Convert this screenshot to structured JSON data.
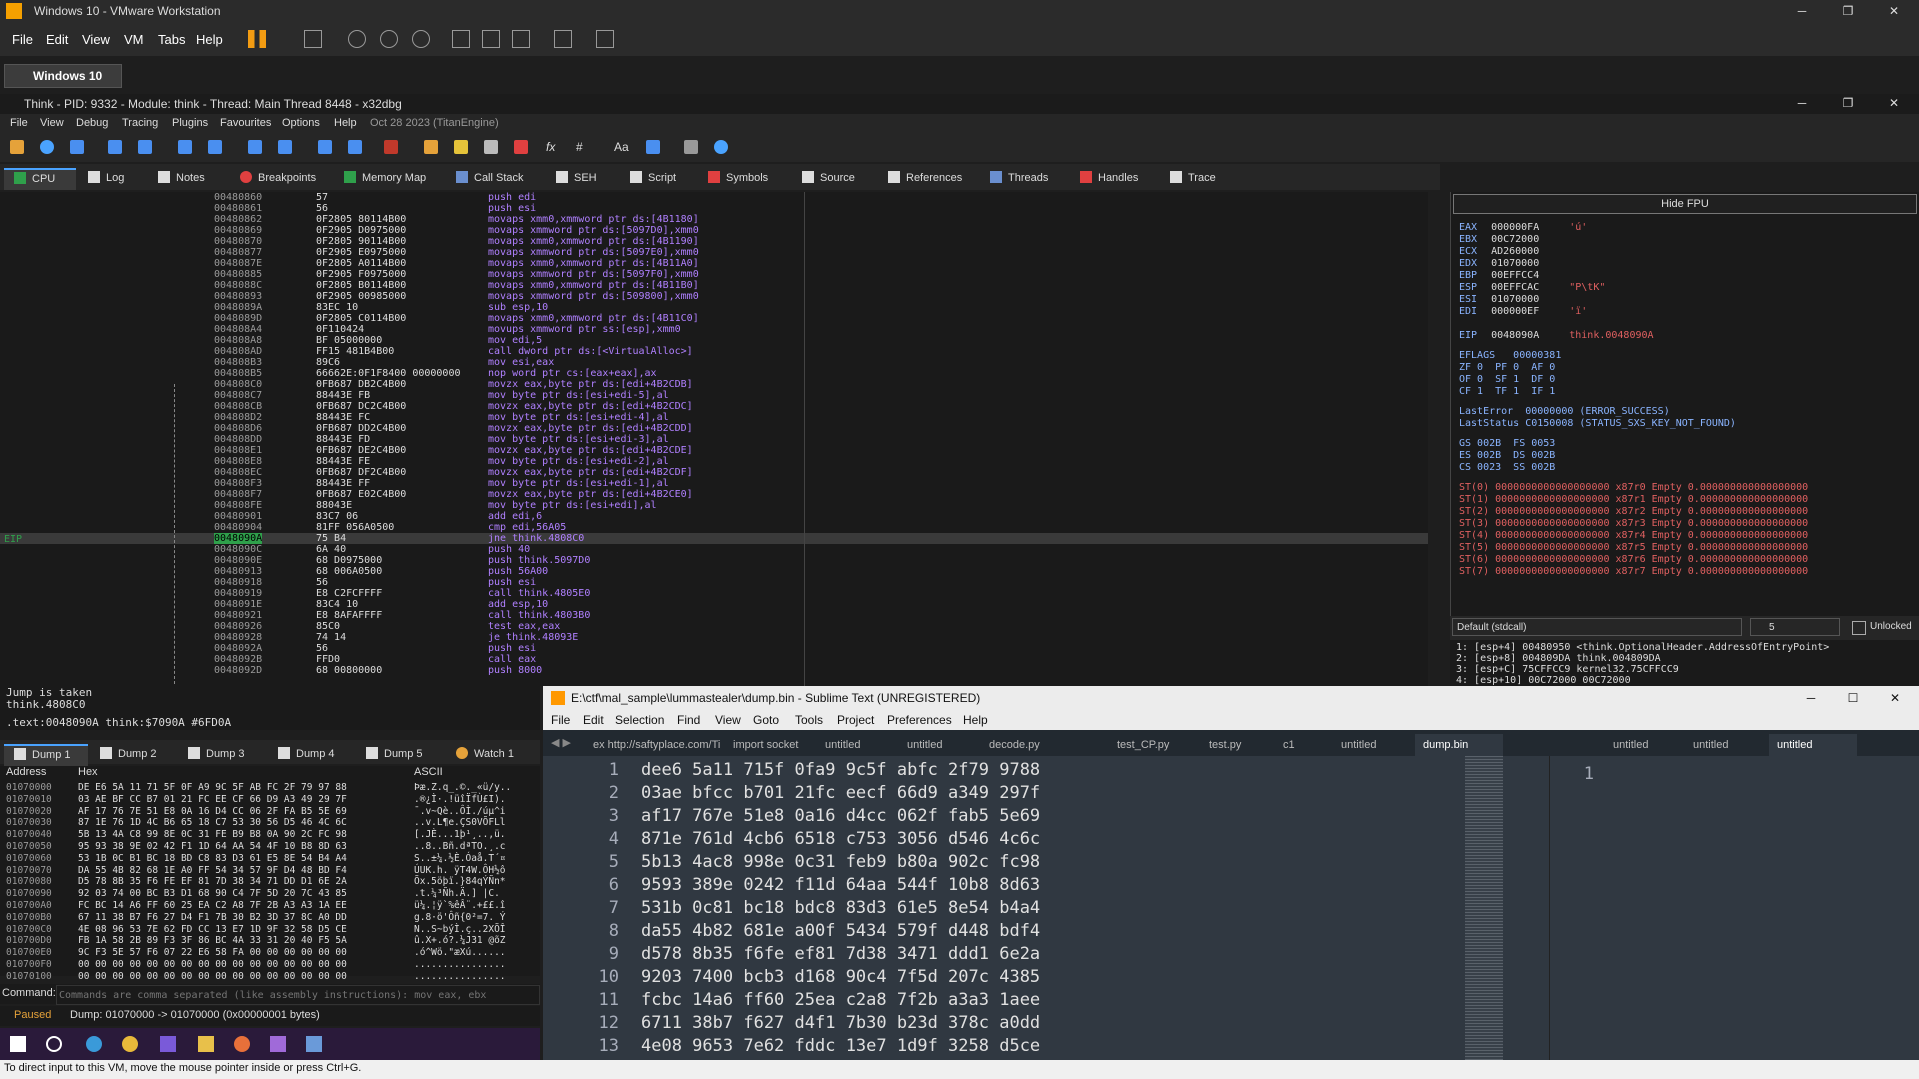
{
  "vmware": {
    "title": "Windows 10 - VMware Workstation",
    "menu": [
      "File",
      "Edit",
      "View",
      "VM",
      "Tabs",
      "Help"
    ],
    "tab": "Windows 10",
    "status": "To direct input to this VM, move the mouse pointer inside or press Ctrl+G."
  },
  "x64dbg": {
    "title": "Think - PID: 9332 - Module: think - Thread: Main Thread 8448 - x32dbg",
    "menu": [
      "File",
      "View",
      "Debug",
      "Tracing",
      "Plugins",
      "Favourites",
      "Options",
      "Help",
      "Oct 28 2023 (TitanEngine)"
    ],
    "tabs": [
      "CPU",
      "Log",
      "Notes",
      "Breakpoints",
      "Memory Map",
      "Call Stack",
      "SEH",
      "Script",
      "Symbols",
      "Source",
      "References",
      "Threads",
      "Handles",
      "Trace"
    ],
    "eip_label": "EIP",
    "disasm": [
      [
        "00480860",
        "57",
        "push edi"
      ],
      [
        "00480861",
        "56",
        "push esi"
      ],
      [
        "00480862",
        "0F2805 80114B00",
        "movaps xmm0,xmmword ptr ds:[4B1180]"
      ],
      [
        "00480869",
        "0F2905 D0975000",
        "movaps xmmword ptr ds:[5097D0],xmm0"
      ],
      [
        "00480870",
        "0F2805 90114B00",
        "movaps xmm0,xmmword ptr ds:[4B1190]"
      ],
      [
        "00480877",
        "0F2905 E0975000",
        "movaps xmmword ptr ds:[5097E0],xmm0"
      ],
      [
        "0048087E",
        "0F2805 A0114B00",
        "movaps xmm0,xmmword ptr ds:[4B11A0]"
      ],
      [
        "00480885",
        "0F2905 F0975000",
        "movaps xmmword ptr ds:[5097F0],xmm0"
      ],
      [
        "0048088C",
        "0F2805 B0114B00",
        "movaps xmm0,xmmword ptr ds:[4B11B0]"
      ],
      [
        "00480893",
        "0F2905 00985000",
        "movaps xmmword ptr ds:[509800],xmm0"
      ],
      [
        "0048089A",
        "83EC 10",
        "sub esp,10"
      ],
      [
        "0048089D",
        "0F2805 C0114B00",
        "movaps xmm0,xmmword ptr ds:[4B11C0]"
      ],
      [
        "004808A4",
        "0F110424",
        "movups xmmword ptr ss:[esp],xmm0"
      ],
      [
        "004808A8",
        "BF 05000000",
        "mov edi,5"
      ],
      [
        "004808AD",
        "FF15 481B4B00",
        "call dword ptr ds:[<VirtualAlloc>]"
      ],
      [
        "004808B3",
        "89C6",
        "mov esi,eax"
      ],
      [
        "004808B5",
        "66662E:0F1F8400 00000000",
        "nop word ptr cs:[eax+eax],ax"
      ],
      [
        "004808C0",
        "0FB687 DB2C4B00",
        "movzx eax,byte ptr ds:[edi+4B2CDB]"
      ],
      [
        "004808C7",
        "88443E FB",
        "mov byte ptr ds:[esi+edi-5],al"
      ],
      [
        "004808CB",
        "0FB687 DC2C4B00",
        "movzx eax,byte ptr ds:[edi+4B2CDC]"
      ],
      [
        "004808D2",
        "88443E FC",
        "mov byte ptr ds:[esi+edi-4],al"
      ],
      [
        "004808D6",
        "0FB687 DD2C4B00",
        "movzx eax,byte ptr ds:[edi+4B2CDD]"
      ],
      [
        "004808DD",
        "88443E FD",
        "mov byte ptr ds:[esi+edi-3],al"
      ],
      [
        "004808E1",
        "0FB687 DE2C4B00",
        "movzx eax,byte ptr ds:[edi+4B2CDE]"
      ],
      [
        "004808E8",
        "88443E FE",
        "mov byte ptr ds:[esi+edi-2],al"
      ],
      [
        "004808EC",
        "0FB687 DF2C4B00",
        "movzx eax,byte ptr ds:[edi+4B2CDF]"
      ],
      [
        "004808F3",
        "88443E FF",
        "mov byte ptr ds:[esi+edi-1],al"
      ],
      [
        "004808F7",
        "0FB687 E02C4B00",
        "movzx eax,byte ptr ds:[edi+4B2CE0]"
      ],
      [
        "004808FE",
        "88043E",
        "mov byte ptr ds:[esi+edi],al"
      ],
      [
        "00480901",
        "83C7 06",
        "add edi,6"
      ],
      [
        "00480904",
        "81FF 056A0500",
        "cmp edi,56A05"
      ],
      [
        "0048090A",
        "75 B4",
        "jne think.4808C0"
      ],
      [
        "0048090C",
        "6A 40",
        "push 40"
      ],
      [
        "0048090E",
        "68 D0975000",
        "push think.5097D0"
      ],
      [
        "00480913",
        "68 006A0500",
        "push 56A00"
      ],
      [
        "00480918",
        "56",
        "push esi"
      ],
      [
        "00480919",
        "E8 C2FCFFFF",
        "call think.4805E0"
      ],
      [
        "0048091E",
        "83C4 10",
        "add esp,10"
      ],
      [
        "00480921",
        "E8 8AFAFFFF",
        "call think.4803B0"
      ],
      [
        "00480926",
        "85C0",
        "test eax,eax"
      ],
      [
        "00480928",
        "74 14",
        "je think.48093E"
      ],
      [
        "0048092A",
        "56",
        "push esi"
      ],
      [
        "0048092B",
        "FFD0",
        "call eax"
      ],
      [
        "0048092D",
        "68 00800000",
        "push 8000"
      ]
    ],
    "info": [
      "Jump is taken",
      "think.4808C0",
      ".text:0048090A think:$7090A #6FD0A"
    ],
    "hide_fpu": "Hide FPU",
    "registers": [
      [
        "EAX",
        "000000FA",
        "'ú'"
      ],
      [
        "EBX",
        "00C72000",
        ""
      ],
      [
        "ECX",
        "AD260000",
        ""
      ],
      [
        "EDX",
        "01070000",
        ""
      ],
      [
        "EBP",
        "00EFFCC4",
        ""
      ],
      [
        "ESP",
        "00EFFCAC",
        "\"P\\tK\""
      ],
      [
        "ESI",
        "01070000",
        ""
      ],
      [
        "EDI",
        "000000EF",
        "'ï'"
      ],
      [
        "",
        "",
        ""
      ],
      [
        "EIP",
        "0048090A",
        "think.0048090A"
      ]
    ],
    "flags": [
      "EFLAGS   00000381",
      "ZF 0  PF 0  AF 0",
      "OF 0  SF 1  DF 0",
      "CF 1  TF 1  IF 1"
    ],
    "errors": [
      "LastError  00000000 (ERROR_SUCCESS)",
      "LastStatus C0150008 (STATUS_SXS_KEY_NOT_FOUND)"
    ],
    "segs": [
      "GS 002B  FS 0053",
      "ES 002B  DS 002B",
      "CS 0023  SS 002B"
    ],
    "fpu": [
      "ST(0) 0000000000000000000 x87r0 Empty 0.000000000000000000",
      "ST(1) 0000000000000000000 x87r1 Empty 0.000000000000000000",
      "ST(2) 0000000000000000000 x87r2 Empty 0.000000000000000000",
      "ST(3) 0000000000000000000 x87r3 Empty 0.000000000000000000",
      "ST(4) 0000000000000000000 x87r4 Empty 0.000000000000000000",
      "ST(5) 0000000000000000000 x87r5 Empty 0.000000000000000000",
      "ST(6) 0000000000000000000 x87r6 Empty 0.000000000000000000",
      "ST(7) 0000000000000000000 x87r7 Empty 0.000000000000000000"
    ],
    "callconv": "Default (stdcall)",
    "argcount": "5",
    "unlocked": "Unlocked",
    "stack": [
      "1: [esp+4] 00480950 <think.OptionalHeader.AddressOfEntryPoint>",
      "2: [esp+8] 004809DA think.004809DA",
      "3: [esp+C] 75CFFCC9 kernel32.75CFFCC9",
      "4: [esp+10] 00C72000 00C72000"
    ],
    "dump_tabs": [
      "Dump 1",
      "Dump 2",
      "Dump 3",
      "Dump 4",
      "Dump 5",
      "Watch 1"
    ],
    "dump_headers": [
      "Address",
      "Hex",
      "ASCII"
    ],
    "dump": [
      [
        "01070000",
        "DE E6 5A 11 71 5F 0F A9 9C 5F AB FC 2F 79 97 88",
        "Þæ.Z.q_.©._«ü/y.."
      ],
      [
        "01070010",
        "03 AE BF CC B7 01 21 FC EE CF 66 D9 A3 49 29 7F",
        ".®¿Ì·.!üîÏfÙ£I)."
      ],
      [
        "01070020",
        "AF 17 76 7E 51 E8 0A 16 D4 CC 06 2F FA B5 5E 69",
        "¯.v~Qè..ÔÌ./úµ^i"
      ],
      [
        "01070030",
        "87 1E 76 1D 4C B6 65 18 C7 53 30 56 D5 46 4C 6C",
        "..v.L¶e.ÇS0VÕFLl"
      ],
      [
        "01070040",
        "5B 13 4A C8 99 8E 0C 31 FE B9 B8 0A 90 2C FC 98",
        "[.JÈ...1þ¹¸..,ü."
      ],
      [
        "01070050",
        "95 93 38 9E 02 42 F1 1D 64 AA 54 4F 10 B8 8D 63",
        "..8..Bñ.dªTO.¸.c"
      ],
      [
        "01070060",
        "53 1B 0C B1 BC 18 BD C8 83 D3 61 E5 8E 54 B4 A4",
        "S..±¼.½È.Óaå.T´¤"
      ],
      [
        "01070070",
        "DA 55 4B 82 68 1E A0 FF 54 34 57 9F D4 48 BD F4",
        "ÚUK.h. ÿT4W.ÔH½ô"
      ],
      [
        "01070080",
        "D5 78 8B 35 F6 FE EF 81 7D 38 34 71 DD D1 6E 2A",
        "Õx.5öþï.}84qÝÑn*"
      ],
      [
        "01070090",
        "92 03 74 00 BC B3 D1 68 90 C4 7F 5D 20 7C 43 85",
        ".t.¼³Ñh.Ä.] |C."
      ],
      [
        "010700A0",
        "FC BC 14 A6 FF 60 25 EA C2 A8 7F 2B A3 A3 1A EE",
        "ü¼.¦ÿ`%êÂ¨.+££.î"
      ],
      [
        "010700B0",
        "67 11 38 B7 F6 27 D4 F1 7B 30 B2 3D 37 8C A0 DD",
        "g.8·ö'Ôñ{0²=7. Ý"
      ],
      [
        "010700C0",
        "4E 08 96 53 7E 62 FD CC 13 E7 1D 9F 32 58 D5 CE",
        "N..S~býÌ.ç..2XÕÎ"
      ],
      [
        "010700D0",
        "FB 1A 58 2B 89 F3 3F 86 BC 4A 33 31 20 40 F5 5A",
        "û.X+.ó?.¼J31 @õZ"
      ],
      [
        "010700E0",
        "9C F3 5E 57 F6 07 22 E6 58 FA 00 00 00 00 00 00",
        ".ó^Wö.\"æXú......"
      ],
      [
        "010700F0",
        "00 00 00 00 00 00 00 00 00 00 00 00 00 00 00 00",
        "................"
      ],
      [
        "01070100",
        "00 00 00 00 00 00 00 00 00 00 00 00 00 00 00 00",
        "................"
      ]
    ],
    "command_label": "Command:",
    "command_placeholder": "Commands are comma separated (like assembly instructions): mov eax, ebx",
    "status_paused": "Paused",
    "status_dump": "Dump: 01070000 -> 01070000 (0x00000001 bytes)"
  },
  "sublime": {
    "title": "E:\\ctf\\mal_sample\\lummastealer\\dump.bin - Sublime Text (UNREGISTERED)",
    "menu": [
      "File",
      "Edit",
      "Selection",
      "Find",
      "View",
      "Goto",
      "Tools",
      "Project",
      "Preferences",
      "Help"
    ],
    "tabs": [
      "ex http://saftyplace.com/Ti",
      "import socket",
      "untitled",
      "untitled",
      "decode.py",
      "test_CP.py",
      "test.py",
      "c1",
      "untitled",
      "dump.bin"
    ],
    "right_tabs": [
      "untitled",
      "untitled",
      "untitled"
    ],
    "lines": [
      "dee6 5a11 715f 0fa9 9c5f abfc 2f79 9788",
      "03ae bfcc b701 21fc eecf 66d9 a349 297f",
      "af17 767e 51e8 0a16 d4cc 062f fab5 5e69",
      "871e 761d 4cb6 6518 c753 3056 d546 4c6c",
      "5b13 4ac8 998e 0c31 feb9 b80a 902c fc98",
      "9593 389e 0242 f11d 64aa 544f 10b8 8d63",
      "531b 0c81 bc18 bdc8 83d3 61e5 8e54 b4a4",
      "da55 4b82 681e a00f 5434 579f d448 bdf4",
      "d578 8b35 f6fe ef81 7d38 3471 ddd1 6e2a",
      "9203 7400 bcb3 d168 90c4 7f5d 207c 4385",
      "fcbc 14a6 ff60 25ea c2a8 7f2b a3a3 1aee",
      "6711 38b7 f627 d4f1 7b30 b23d 378c a0dd",
      "4e08 9653 7e62 fddc 13e7 1d9f 3258 d5ce",
      "fb1a 582b 89f3 3f86 bc4a 3331 2040 f55a"
    ],
    "pane2_line": "1"
  }
}
